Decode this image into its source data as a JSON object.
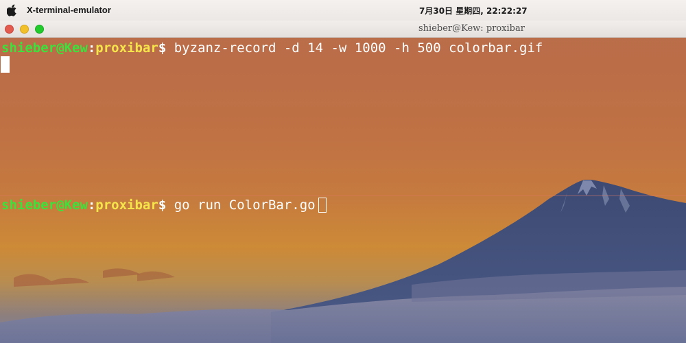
{
  "menubar": {
    "app_name": "X-terminal-emulator",
    "clock": "7月30日 星期四, 22:22:27",
    "apple_icon": "apple-icon"
  },
  "window": {
    "title": "shieber@Kew: proxibar",
    "buttons": [
      "close",
      "minimize",
      "maximize"
    ]
  },
  "terminal": {
    "prompt": {
      "user_host": "shieber@Kew",
      "colon": ":",
      "path": "proxibar",
      "dollar": "$"
    },
    "lines": [
      {
        "command": "byzanz-record -d 14 -w 1000 -h 500 colorbar.gif"
      },
      {
        "command": "go run ColorBar.go"
      }
    ]
  },
  "colors": {
    "prompt_user": "#3ce23c",
    "prompt_path": "#f5e54a",
    "text": "#ffffff"
  }
}
